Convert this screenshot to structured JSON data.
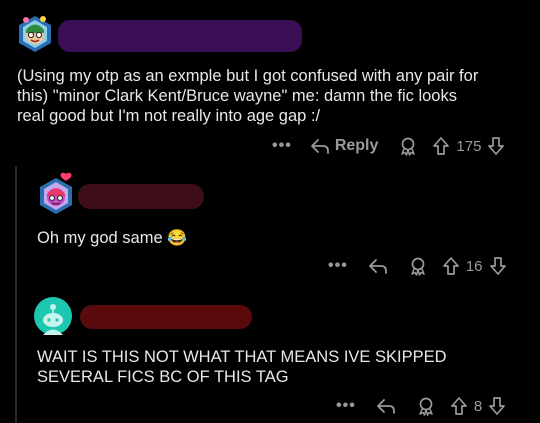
{
  "comments": [
    {
      "id": "c1",
      "text_lines": [
        "(Using my otp as an exmple but I got confused with any pair for",
        "this) \"minor Clark Kent/Bruce wayne\" me: damn the fic looks",
        "real good but I'm not really into age gap :/"
      ],
      "reply_label": "Reply",
      "vote_count": "175",
      "redaction_color": "#3a0f55"
    },
    {
      "id": "c2",
      "text": "Oh my god same",
      "emoji": "😂",
      "vote_count": "16",
      "redaction_color": "#3d0d18"
    },
    {
      "id": "c3",
      "text_lines": [
        "WAIT IS THIS NOT WHAT THAT MEANS IVE SKIPPED",
        "SEVERAL FICS BC OF THIS TAG"
      ],
      "vote_count": "8",
      "redaction_color": "#5a0a0a"
    }
  ],
  "more_label": "•••",
  "colors": {
    "background": "#000000",
    "text": "#e8e8e8",
    "muted": "#9a9a9a",
    "default_avatar": "#1ec8b0"
  },
  "icons": [
    "more-icon",
    "reply-arrow-icon",
    "award-icon",
    "upvote-icon",
    "downvote-icon"
  ]
}
